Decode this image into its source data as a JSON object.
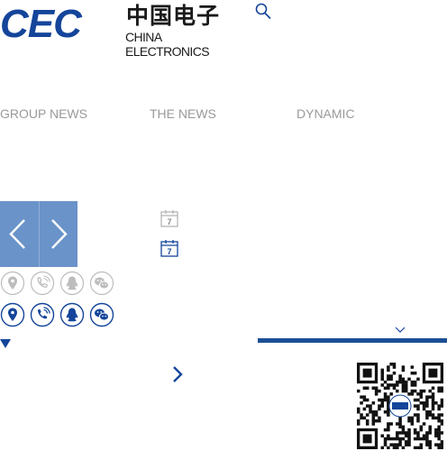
{
  "logo": {
    "mark": "CEC",
    "cn": "中国电子",
    "en": "CHINA ELECTRONICS"
  },
  "nav": {
    "group_news": "GROUP NEWS",
    "the_news": "THE NEWS",
    "dynamic": "DYNAMIC"
  },
  "calendar": {
    "day": "7"
  },
  "colors": {
    "brand": "#14459a",
    "nav": "#9a9a9a",
    "carousel": "#6a93c9",
    "icon_outline": "#bdbdbd",
    "bar": "#1b4f94"
  },
  "icons": {
    "search": "search-icon",
    "prev": "chevron-left-icon",
    "next": "chevron-right-icon",
    "calendar": "calendar-icon",
    "location": "location-icon",
    "phone": "phone-icon",
    "qq": "qq-icon",
    "wechat": "wechat-icon",
    "qr": "qr-code"
  }
}
